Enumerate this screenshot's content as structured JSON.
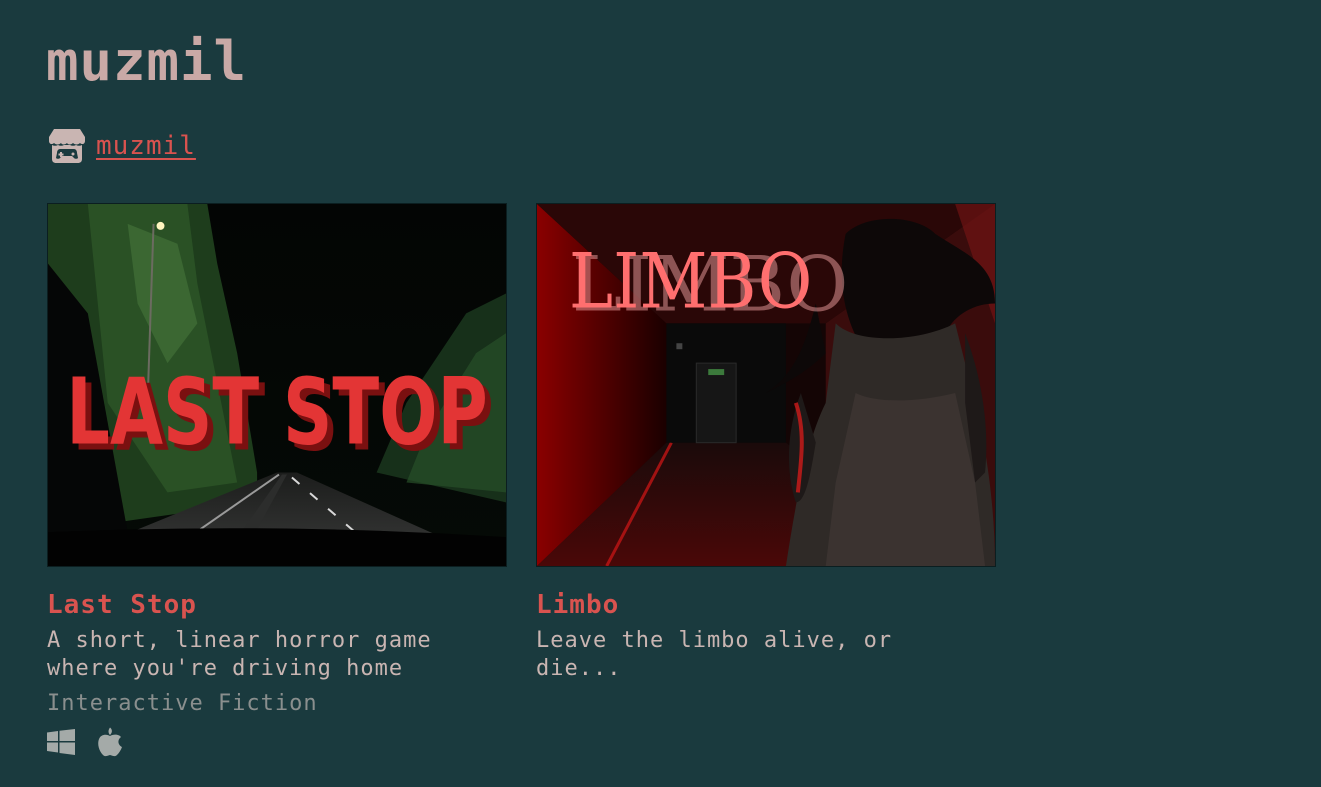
{
  "header": {
    "title": "muzmil"
  },
  "profile": {
    "icon": "itch-store-icon",
    "link_label": "muzmil"
  },
  "games": [
    {
      "title": "Last Stop",
      "thumbnail_text": "LAST STOP",
      "description": "A short, linear horror game where you're driving home",
      "genre": "Interactive Fiction",
      "platforms": [
        "windows-icon",
        "apple-icon"
      ]
    },
    {
      "title": "Limbo",
      "thumbnail_text": "LIMBO",
      "description": "Leave the limbo alive, or die...",
      "genre": "",
      "platforms": []
    }
  ],
  "colors": {
    "background": "#1a3a3e",
    "title": "#c9a9a6",
    "accent": "#d9534f",
    "text": "#c9b5b2",
    "muted": "#8a8f8e"
  }
}
